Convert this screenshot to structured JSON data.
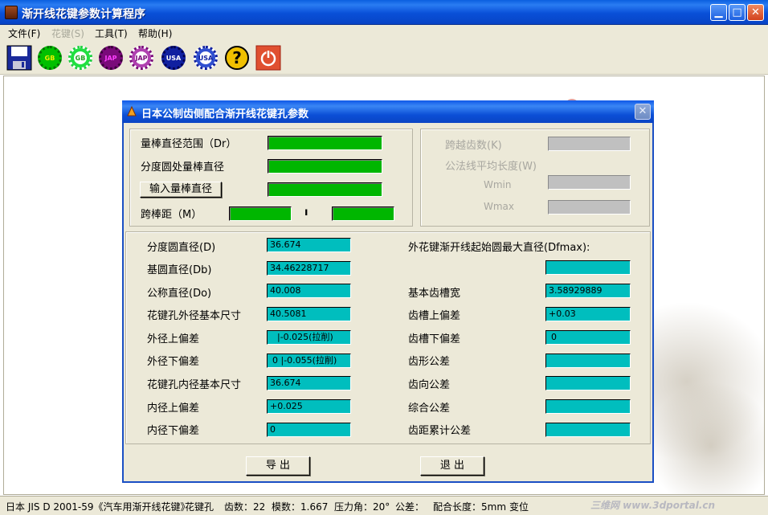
{
  "window": {
    "title": "渐开线花键参数计算程序"
  },
  "menu": [
    {
      "label": "文件(F)",
      "disabled": false
    },
    {
      "label": "花键(S)",
      "disabled": true
    },
    {
      "label": "工具(T)",
      "disabled": false
    },
    {
      "label": "帮助(H)",
      "disabled": false
    }
  ],
  "toolbar": {
    "buttons": [
      {
        "icon": "save-icon"
      },
      {
        "icon": "gb-gear-icon",
        "label": "GB",
        "color": "#00c000"
      },
      {
        "icon": "gb-gear-icon",
        "label": "GB",
        "color": "#20e040"
      },
      {
        "icon": "jap-gear-icon",
        "label": "JAP",
        "color": "#7a0a7a"
      },
      {
        "icon": "jap-gear-icon",
        "label": "JAP",
        "color": "#b040b0"
      },
      {
        "icon": "usa-gear-icon",
        "label": "USA",
        "color": "#1020a0"
      },
      {
        "icon": "usa-gear-icon",
        "label": "USA",
        "color": "#3050d0"
      },
      {
        "icon": "help-icon",
        "label": "?"
      },
      {
        "icon": "exit-icon"
      }
    ]
  },
  "dialog": {
    "title": "日本公制齿侧配合渐开线花键孔参数",
    "dr_range_label": "量棒直径范围（Dr）",
    "pitch_rod_label": "分度圆处量棒直径",
    "input_rod_button": "输入量棒直径",
    "span_label": "跨棒距（M）",
    "span_separator": "ı",
    "cross_teeth_label": "跨越齿数(K)",
    "common_normal_label": "公法线平均长度(W)",
    "wmin_label": "Wmin",
    "wmax_label": "Wmax",
    "left_fields": [
      {
        "label": "分度圆直径(D)",
        "value": "36.674"
      },
      {
        "label": "基圆直径(Db)",
        "value": "34.46228717"
      },
      {
        "label": "公称直径(Do)",
        "value": "40.008"
      },
      {
        "label": "花键孔外径基本尺寸",
        "value": "40.5081"
      },
      {
        "label": "外径上偏差",
        "value": "|-0.025(拉削)"
      },
      {
        "label": "外径下偏差",
        "value": "0 |-0.055(拉削)"
      },
      {
        "label": "花键孔内径基本尺寸",
        "value": "36.674"
      },
      {
        "label": "内径上偏差",
        "value": "+0.025"
      },
      {
        "label": "内径下偏差",
        "value": "0"
      }
    ],
    "dfmax_label": "外花键渐开线起始圆最大直径(Dfmax):",
    "dfmax_value": "",
    "right_fields": [
      {
        "label": "基本齿槽宽",
        "value": "3.58929889"
      },
      {
        "label": "齿槽上偏差",
        "value": "+0.03"
      },
      {
        "label": "齿槽下偏差",
        "value": "0"
      },
      {
        "label": "齿形公差",
        "value": ""
      },
      {
        "label": "齿向公差",
        "value": ""
      },
      {
        "label": "综合公差",
        "value": ""
      },
      {
        "label": "齿距累计公差",
        "value": ""
      }
    ],
    "export_button": "导 出",
    "exit_button": "退 出"
  },
  "status": {
    "standard": "日本 JIS D 2001-59《汽车用渐开线花键》",
    "type": "花键孔",
    "teeth": "齿数：22",
    "module": "模数：1.667",
    "pressure_angle": "压力角：20°",
    "tolerance": "公差：",
    "fit_length": "配合长度：5mm",
    "modification": "变位"
  },
  "watermark": "三维网 www.3dportal.cn",
  "colors": {
    "field_teal": "#00bebe",
    "field_green": "#00b600",
    "field_gray": "#c0c0c0"
  }
}
